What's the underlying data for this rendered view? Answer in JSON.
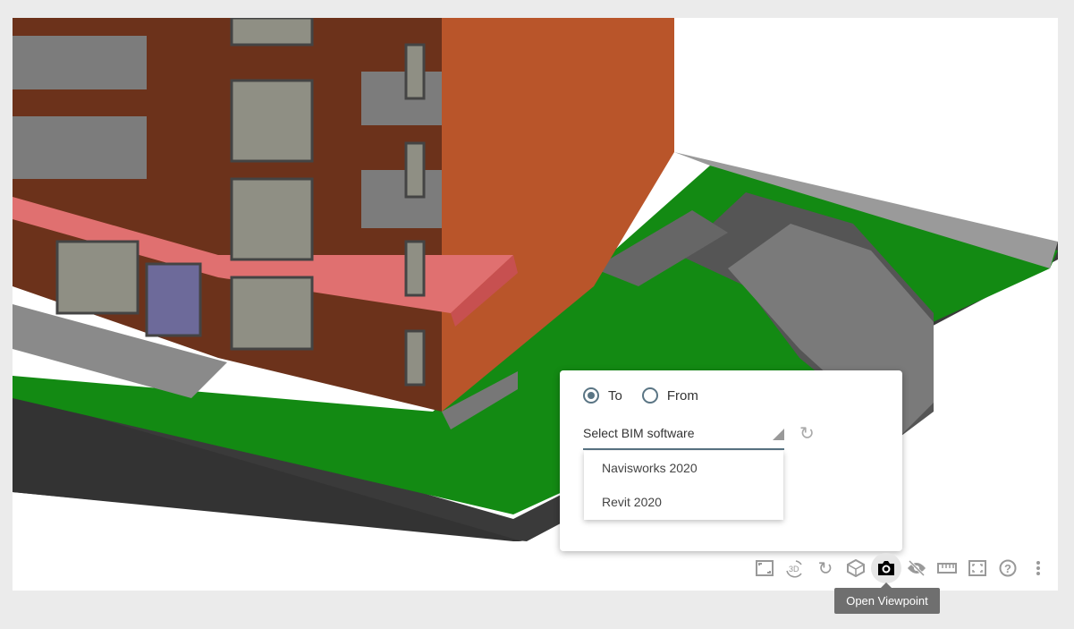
{
  "popup": {
    "radio_to": "To",
    "radio_from": "From",
    "selected_direction": "To",
    "select_placeholder": "Select BIM software",
    "options": [
      "Navisworks 2020",
      "Revit 2020"
    ]
  },
  "toolbar": {
    "icons": [
      "fit-view-icon",
      "rotate-3d-icon",
      "reset-icon",
      "cube-icon",
      "camera-icon",
      "hide-icon",
      "measure-ruler-icon",
      "fullscreen-icon",
      "help-icon",
      "more-vert-icon"
    ],
    "active": "camera-icon"
  },
  "tooltip": "Open Viewpoint"
}
